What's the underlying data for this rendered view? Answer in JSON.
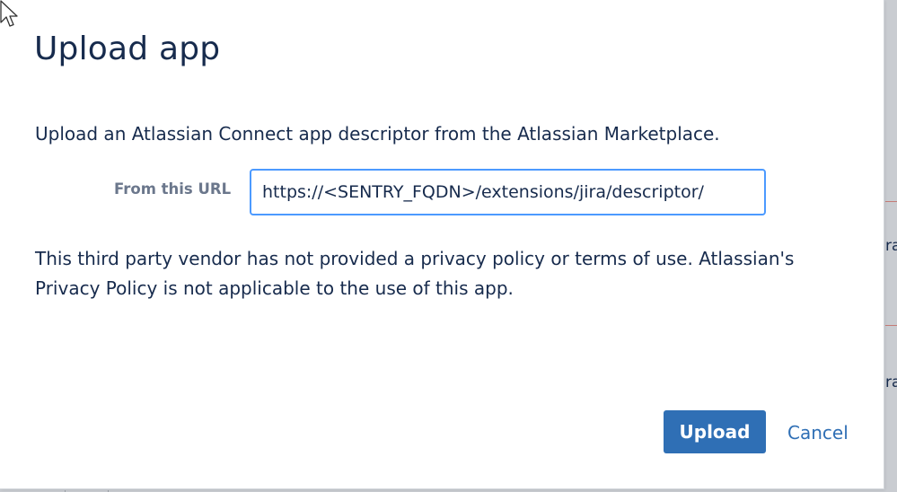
{
  "dialog": {
    "title": "Upload app",
    "intro_text": "Upload an Atlassian Connect app descriptor from the Atlassian Marketplace.",
    "url_field": {
      "label": "From this URL",
      "value": "https://<SENTRY_FQDN>/extensions/jira/descriptor/"
    },
    "privacy_text": "This third party vendor has not provided a privacy policy or terms of use. Atlassian's Privacy Policy is not applicable to the use of this app.",
    "upload_label": "Upload",
    "cancel_label": "Cancel"
  },
  "background": {
    "fragment_1": "ra",
    "fragment_2": "ra"
  },
  "colors": {
    "text": "#172b4d",
    "label": "#6b778c",
    "primary": "#2f6fb5",
    "focus_border": "#4c9aff"
  },
  "icons": {
    "pointer": "mouse-pointer-icon"
  }
}
